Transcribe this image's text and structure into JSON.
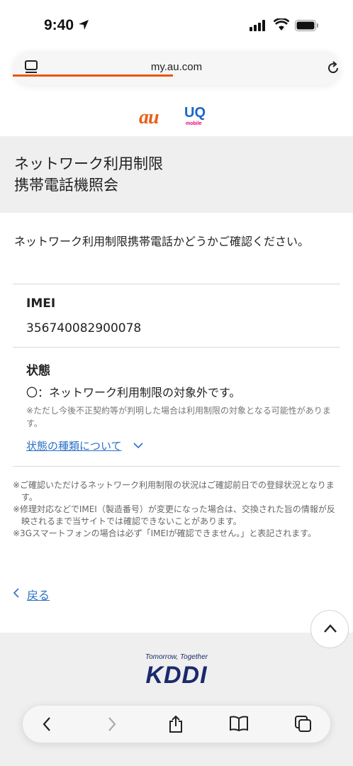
{
  "status_bar": {
    "time": "9:40"
  },
  "browser": {
    "url": "my.au.com"
  },
  "brand": {
    "au": "au",
    "uq": "UQ",
    "uq_sub": "mobile"
  },
  "page": {
    "title_line1": "ネットワーク利用制限",
    "title_line2": "携帯電話機照会",
    "intro": "ネットワーク利用制限携帯電話かどうかご確認ください。"
  },
  "imei": {
    "label": "IMEI",
    "value": "356740082900078"
  },
  "status": {
    "label": "状態",
    "value": "〇：ネットワーク利用制限の対象外です。",
    "note": "※ただし今後不正契約等が判明した場合は利用制限の対象となる可能性があります。",
    "link": "状態の種類について"
  },
  "notes": [
    "※ご確認いただけるネットワーク利用制限の状況はご確認前日での登録状況となります。",
    "※修理対応などでIMEI（製造番号）が変更になった場合は、交換された旨の情報が反映されるまで当サイトでは確認できないことがあります。",
    "※3Gスマートフォンの場合は必ず「IMEIが確認できません。」と表記されます。"
  ],
  "back_link": "戻る",
  "footer": {
    "tagline": "Tomorrow, Together",
    "logo": "KDDI"
  },
  "colors": {
    "accent": "#eb5505",
    "link": "#2a70c8",
    "band": "#efefef"
  }
}
